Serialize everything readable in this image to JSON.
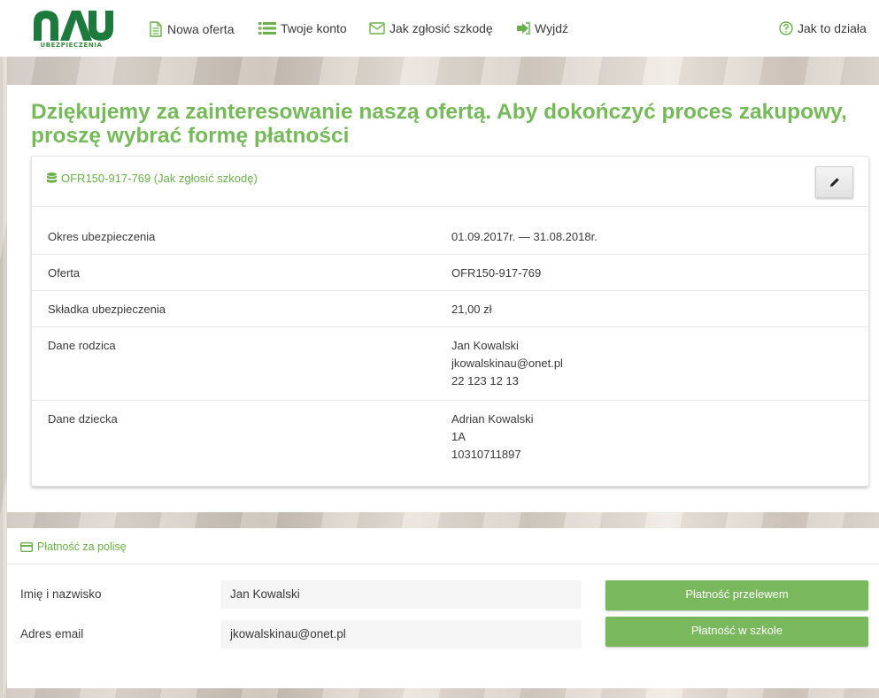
{
  "brand": {
    "name": "UBEZPIECZENIA",
    "color": "#1e7a3c"
  },
  "nav": {
    "new_offer": "Nowa oferta",
    "account": "Twoje konto",
    "report_claim": "Jak zgłosić szkodę",
    "logout": "Wyjdź",
    "how_it_works": "Jak to działa"
  },
  "heading": "Dziękujemy za zainteresowanie naszą ofertą. Aby dokończyć proces zakupowy, proszę wybrać formę płatności",
  "offer_card": {
    "title": "OFR150-917-769 (Jak zgłosić szkodę)",
    "edit_icon": "pencil-icon",
    "rows": [
      {
        "label": "Okres ubezpieczenia",
        "lines": [
          "01.09.2017r. — 31.08.2018r."
        ]
      },
      {
        "label": "Oferta",
        "lines": [
          "OFR150-917-769"
        ]
      },
      {
        "label": "Składka ubezpieczenia",
        "lines": [
          "21,00 zł"
        ]
      },
      {
        "label": "Dane rodzica",
        "lines": [
          "Jan Kowalski",
          "jkowalskinau@onet.pl",
          "22 123 12 13"
        ]
      },
      {
        "label": "Dane dziecka",
        "lines": [
          "Adrian Kowalski",
          "1A",
          "10310711897"
        ]
      }
    ]
  },
  "payment": {
    "title": "Płatność za polisę",
    "name_label": "Imię i nazwisko",
    "name_value": "Jan Kowalski",
    "email_label": "Adres email",
    "email_value": "jkowalskinau@onet.pl",
    "transfer_button": "Płatność przelewem",
    "school_button": "Płatność w szkole"
  },
  "colors": {
    "accent": "#76b95a",
    "button": "#7ab85d",
    "nav_icon": "#6ab04c"
  }
}
